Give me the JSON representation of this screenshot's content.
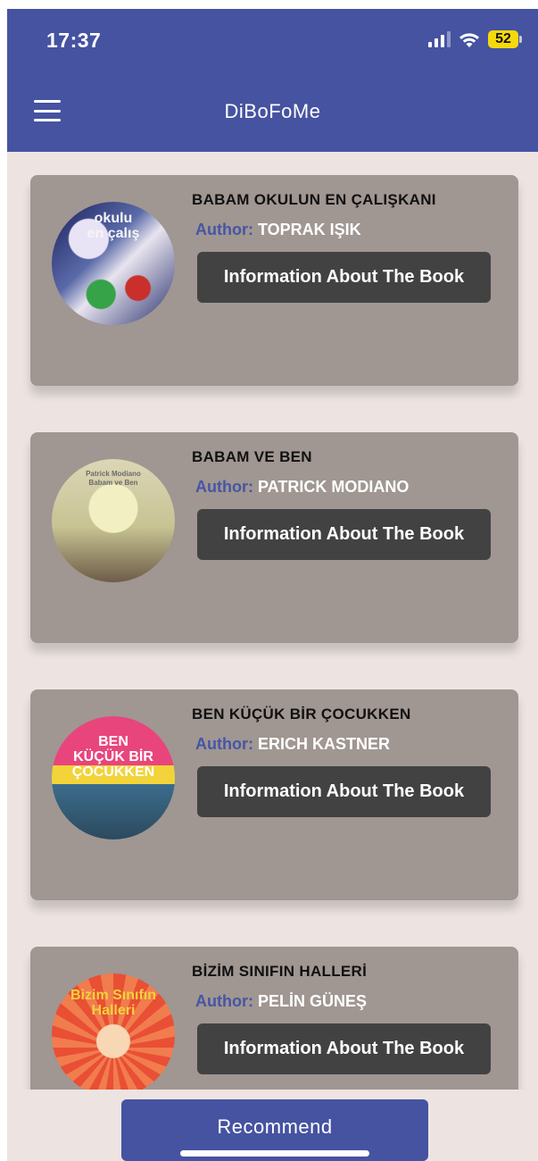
{
  "status_bar": {
    "time": "17:37",
    "battery": "52"
  },
  "header": {
    "title": "DiBoFoMe"
  },
  "books": [
    {
      "title": "BABAM OKULUN EN ÇALIŞKANI",
      "author_label": "Author:",
      "author": "TOPRAK IŞIK",
      "button_label": "Information About The Book",
      "cover_text": "okulu\nen çalış"
    },
    {
      "title": "BABAM VE BEN",
      "author_label": "Author:",
      "author": "PATRICK MODIANO",
      "button_label": "Information About The Book",
      "cover_text": "Patrick Modiano\nBabam ve Ben"
    },
    {
      "title": "BEN KÜÇÜK BİR ÇOCUKKEN",
      "author_label": "Author:",
      "author": "ERICH KASTNER",
      "button_label": "Information About The Book",
      "cover_text": "BEN\nKÜÇÜK BİR\nÇOCUKKEN"
    },
    {
      "title": "BİZİM SINIFIN HALLERİ",
      "author_label": "Author:",
      "author": "PELİN GÜNEŞ",
      "button_label": "Information About The Book",
      "cover_text": "Bizim Sınıfın\nHalleri"
    }
  ],
  "footer": {
    "recommend_label": "Recommend"
  },
  "colors": {
    "primary": "#4553a1",
    "card": "#a09692",
    "button": "#424242",
    "background": "#ede4e1"
  }
}
